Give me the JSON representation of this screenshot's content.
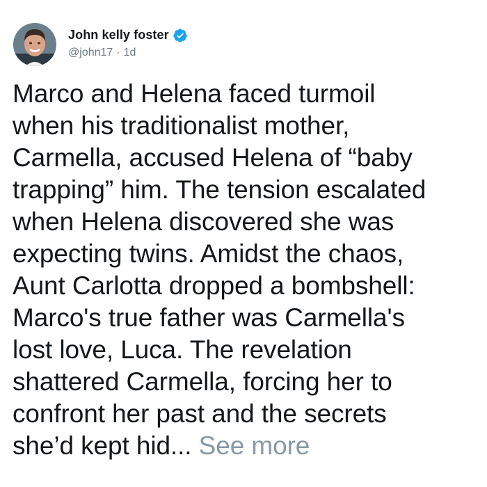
{
  "author": {
    "display_name": "John kelly foster",
    "handle": "@john17",
    "separator": "·",
    "timestamp": "1d",
    "verified": true,
    "verified_color": "#1da1f2"
  },
  "tweet": {
    "lines": [
      "Marco and Helena faced turmoil",
      "when his traditionalist mother,",
      "Carmella, accused Helena of “baby",
      "trapping” him. The tension escalated",
      "when Helena discovered she was",
      "expecting twins. Amidst the chaos,",
      "Aunt Carlotta dropped a bombshell:",
      "Marco's true father was Carmella's",
      "lost love, Luca. The revelation",
      "shattered Carmella, forcing her to",
      "confront her past and the secrets",
      "she’d kept hid..."
    ],
    "see_more_label": "See more",
    "text_color": "#14171a",
    "see_more_color": "#8899a6"
  }
}
